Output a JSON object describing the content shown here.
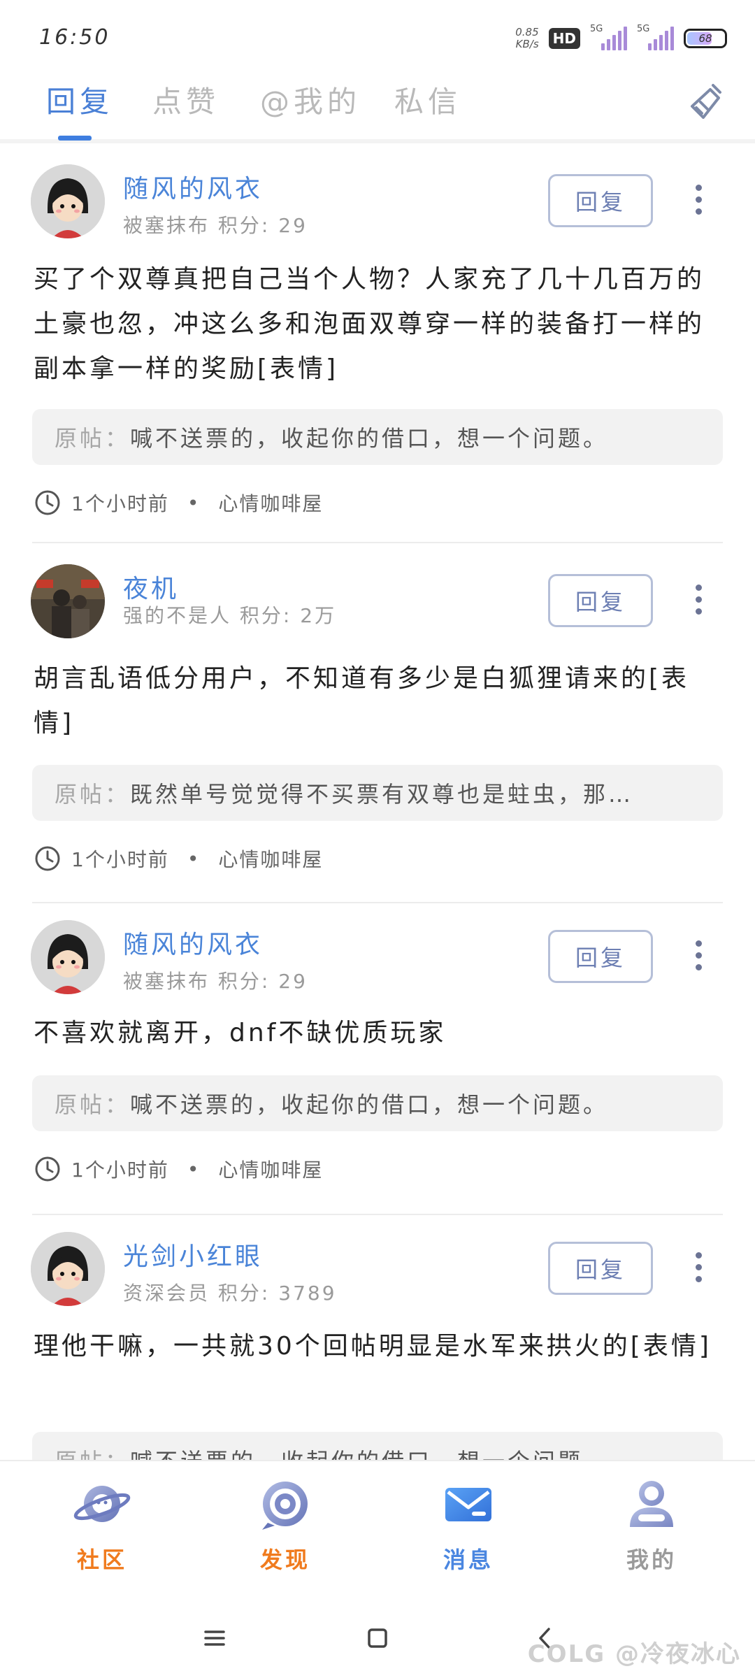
{
  "status_bar": {
    "time": "16:50",
    "net_speed_value": "0.85",
    "net_speed_unit": "KB/s",
    "hd_label": "HD",
    "network_1": "5G",
    "network_2": "5G",
    "battery": "68"
  },
  "tabs": [
    {
      "label": "回复",
      "active": true
    },
    {
      "label": "点赞",
      "active": false
    },
    {
      "label": "@我的",
      "active": false
    },
    {
      "label": "私信",
      "active": false
    }
  ],
  "cards": [
    {
      "username": "随风的风衣",
      "title": "被塞抹布",
      "points_label": "积分:",
      "points": "29",
      "reply_label": "回复",
      "content": "买了个双尊真把自己当个人物？人家充了几十几百万的土豪也忽，冲这么多和泡面双尊穿一样的装备打一样的副本拿一样的奖励[表情]",
      "origin_prefix": "原帖：",
      "origin_text": "喊不送票的，收起你的借口，想一个问题。",
      "time_ago": "1个小时前",
      "board": "心情咖啡屋"
    },
    {
      "username": "夜机",
      "title": "强的不是人",
      "points_label": "积分:",
      "points": "2万",
      "reply_label": "回复",
      "content": "胡言乱语低分用户，不知道有多少是白狐狸请来的[表情]",
      "origin_prefix": "原帖：",
      "origin_text": "既然单号觉觉得不买票有双尊也是蛀虫，那…",
      "time_ago": "1个小时前",
      "board": "心情咖啡屋"
    },
    {
      "username": "随风的风衣",
      "title": "被塞抹布",
      "points_label": "积分:",
      "points": "29",
      "reply_label": "回复",
      "content": "不喜欢就离开，dnf不缺优质玩家",
      "origin_prefix": "原帖：",
      "origin_text": "喊不送票的，收起你的借口，想一个问题。",
      "time_ago": "1个小时前",
      "board": "心情咖啡屋"
    },
    {
      "username": "光剑小红眼",
      "title": "资深会员",
      "points_label": "积分:",
      "points": "3789",
      "reply_label": "回复",
      "content": "理他干嘛，一共就30个回帖明显是水军来拱火的[表情]",
      "origin_prefix": "原帖：",
      "origin_text": "喊不送票的，收起你的借口，想一个问题。"
    }
  ],
  "bottom_nav": [
    {
      "label": "社区",
      "color": "#f07b1e"
    },
    {
      "label": "发现",
      "color": "#f07b1e"
    },
    {
      "label": "消息",
      "color": "#4a86e0"
    },
    {
      "label": "我的",
      "color": "#9a9a9a"
    }
  ],
  "watermark": "COLG @冷夜冰心",
  "colors": {
    "accent_blue": "#4a80d6",
    "tab_inactive": "#b9b9b9",
    "username_blue": "#4a84d8",
    "reply_border": "#b5bfd8",
    "origin_bg": "#f2f2f2"
  }
}
